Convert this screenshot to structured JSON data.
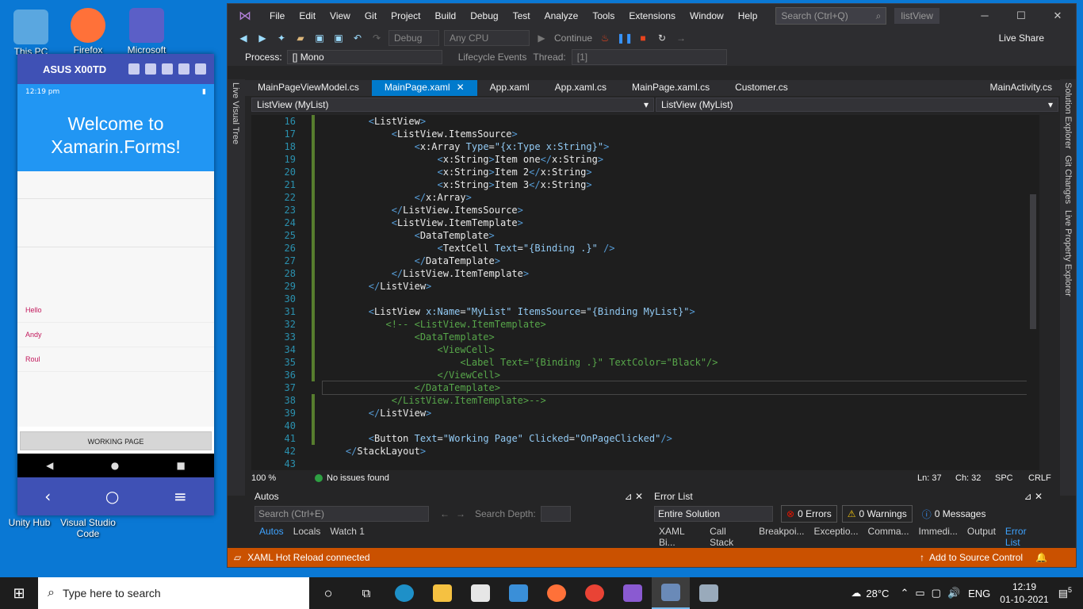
{
  "desktop": {
    "icons": [
      {
        "label": "This PC"
      },
      {
        "label": "Firefox"
      },
      {
        "label": "Microsoft"
      },
      {
        "label": "Unity Hub"
      },
      {
        "label": "Visual Studio Code"
      }
    ]
  },
  "emulator": {
    "title": "ASUS X00TD",
    "status_time": "12:19 pm",
    "header": "Welcome to Xamarin.Forms!",
    "list_items": [
      "Hello",
      "Andy",
      "Roul"
    ],
    "button_label": "WORKING PAGE"
  },
  "vs": {
    "menu": [
      "File",
      "Edit",
      "View",
      "Git",
      "Project",
      "Build",
      "Debug",
      "Test",
      "Analyze",
      "Tools",
      "Extensions",
      "Window",
      "Help"
    ],
    "search_placeholder": "Search (Ctrl+Q)",
    "project_badge": "listView",
    "toolbar": {
      "config": "Debug",
      "platform": "Any CPU",
      "continue": "Continue",
      "live_share": "Live Share"
    },
    "toolbar2": {
      "process_label": "Process:",
      "process_value": "[] Mono",
      "lifecycle": "Lifecycle Events",
      "thread_label": "Thread:",
      "thread_value": "[1]"
    },
    "left_side_tab": "Live Visual Tree",
    "right_side_tabs": [
      "Solution Explorer",
      "Git Changes",
      "Live Property Explorer"
    ],
    "tabs": [
      "MainPageViewModel.cs",
      "MainPage.xaml",
      "App.xaml",
      "App.xaml.cs",
      "MainPage.xaml.cs",
      "Customer.cs"
    ],
    "tab_right": "MainActivity.cs",
    "nav_left": "ListView (MyList)",
    "nav_right": "ListView (MyList)",
    "code_lines": [
      {
        "n": "16",
        "text": "        <ListView>"
      },
      {
        "n": "17",
        "text": "            <ListView.ItemsSource>"
      },
      {
        "n": "18",
        "text": "                <x:Array Type=\"{x:Type x:String}\">"
      },
      {
        "n": "19",
        "text": "                    <x:String>Item one</x:String>"
      },
      {
        "n": "20",
        "text": "                    <x:String>Item 2</x:String>"
      },
      {
        "n": "21",
        "text": "                    <x:String>Item 3</x:String>"
      },
      {
        "n": "22",
        "text": "                </x:Array>"
      },
      {
        "n": "23",
        "text": "            </ListView.ItemsSource>"
      },
      {
        "n": "24",
        "text": "            <ListView.ItemTemplate>"
      },
      {
        "n": "25",
        "text": "                <DataTemplate>"
      },
      {
        "n": "26",
        "text": "                    <TextCell Text=\"{Binding .}\" />"
      },
      {
        "n": "27",
        "text": "                </DataTemplate>"
      },
      {
        "n": "28",
        "text": "            </ListView.ItemTemplate>"
      },
      {
        "n": "29",
        "text": "        </ListView>"
      },
      {
        "n": "30",
        "text": ""
      },
      {
        "n": "31",
        "text": "        <ListView x:Name=\"MyList\" ItemsSource=\"{Binding MyList}\">"
      },
      {
        "n": "32",
        "text": "           <!-- <ListView.ItemTemplate>"
      },
      {
        "n": "33",
        "text": "                <DataTemplate>"
      },
      {
        "n": "34",
        "text": "                    <ViewCell>"
      },
      {
        "n": "35",
        "text": "                        <Label Text=\"{Binding .}\" TextColor=\"Black\"/>"
      },
      {
        "n": "36",
        "text": "                    </ViewCell>"
      },
      {
        "n": "37",
        "text": "                </DataTemplate>"
      },
      {
        "n": "38",
        "text": "            </ListView.ItemTemplate>-->"
      },
      {
        "n": "39",
        "text": "        </ListView>"
      },
      {
        "n": "40",
        "text": ""
      },
      {
        "n": "41",
        "text": "        <Button Text=\"Working Page\" Clicked=\"OnPageClicked\"/>"
      },
      {
        "n": "42",
        "text": "    </StackLayout>"
      },
      {
        "n": "43",
        "text": ""
      }
    ],
    "editor_status": {
      "zoom": "100 %",
      "issues": "No issues found",
      "ln": "Ln: 37",
      "ch": "Ch: 32",
      "spc": "SPC",
      "crlf": "CRLF"
    },
    "autos": {
      "title": "Autos",
      "search_placeholder": "Search (Ctrl+E)",
      "depth_label": "Search Depth:",
      "tabs": [
        "Autos",
        "Locals",
        "Watch 1"
      ]
    },
    "error_list": {
      "title": "Error List",
      "scope": "Entire Solution",
      "errors": "0 Errors",
      "warnings": "0 Warnings",
      "messages": "0 Messages",
      "tabs": [
        "XAML Bi...",
        "Call Stack",
        "Breakpoi...",
        "Exceptio...",
        "Comma...",
        "Immedi...",
        "Output",
        "Error List"
      ]
    },
    "status": {
      "left": "XAML Hot Reload connected",
      "right": "Add to Source Control"
    }
  },
  "taskbar": {
    "search_placeholder": "Type here to search",
    "weather": "28°C",
    "lang": "ENG",
    "time": "12:19",
    "date": "01-10-2021",
    "notifications": "5"
  },
  "colors": {
    "vs_accent": "#007acc",
    "status_orange": "#ca5100",
    "android_blue": "#2196f3",
    "android_indigo": "#3f51b5",
    "desktop_blue": "#0a78d4"
  }
}
